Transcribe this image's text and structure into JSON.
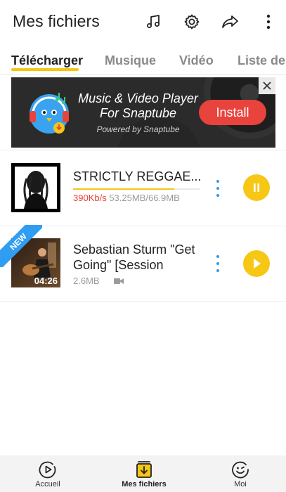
{
  "header": {
    "title": "Mes fichiers",
    "icons": [
      "music-note-icon",
      "gear-icon",
      "share-icon",
      "more-vertical-icon"
    ]
  },
  "tabs": [
    {
      "label": "Télécharger",
      "active": true
    },
    {
      "label": "Musique",
      "active": false
    },
    {
      "label": "Vidéo",
      "active": false
    },
    {
      "label": "Liste de",
      "active": false
    }
  ],
  "ad": {
    "title_line1": "Music & Video Player",
    "title_line2": "For Snaptube",
    "subtitle": "Powered by Snaptube",
    "install_label": "Install",
    "close_icon": "close-icon"
  },
  "files": [
    {
      "title": "STRICTLY REGGAE...",
      "speed": "390Kb/s",
      "size": "53.25MB/66.9MB",
      "progress_fraction": 0.8,
      "action_icon": "pause-icon"
    },
    {
      "title_line1": "Sebastian Sturm \"Get",
      "title_line2": "Going\" [Session",
      "size": "2.6MB",
      "duration": "04:26",
      "badge": "NEW",
      "type_icon": "video-icon",
      "action_icon": "play-icon"
    }
  ],
  "bottom_nav": [
    {
      "label": "Accueil",
      "icon": "play-circle-icon",
      "active": false
    },
    {
      "label": "Mes fichiers",
      "icon": "download-box-icon",
      "active": true
    },
    {
      "label": "Moi",
      "icon": "smiley-icon",
      "active": false
    }
  ],
  "colors": {
    "accent_yellow": "#f5c518",
    "link_blue": "#2d9cf0",
    "speed_red": "#e8433c",
    "install_red": "#e8433c"
  }
}
